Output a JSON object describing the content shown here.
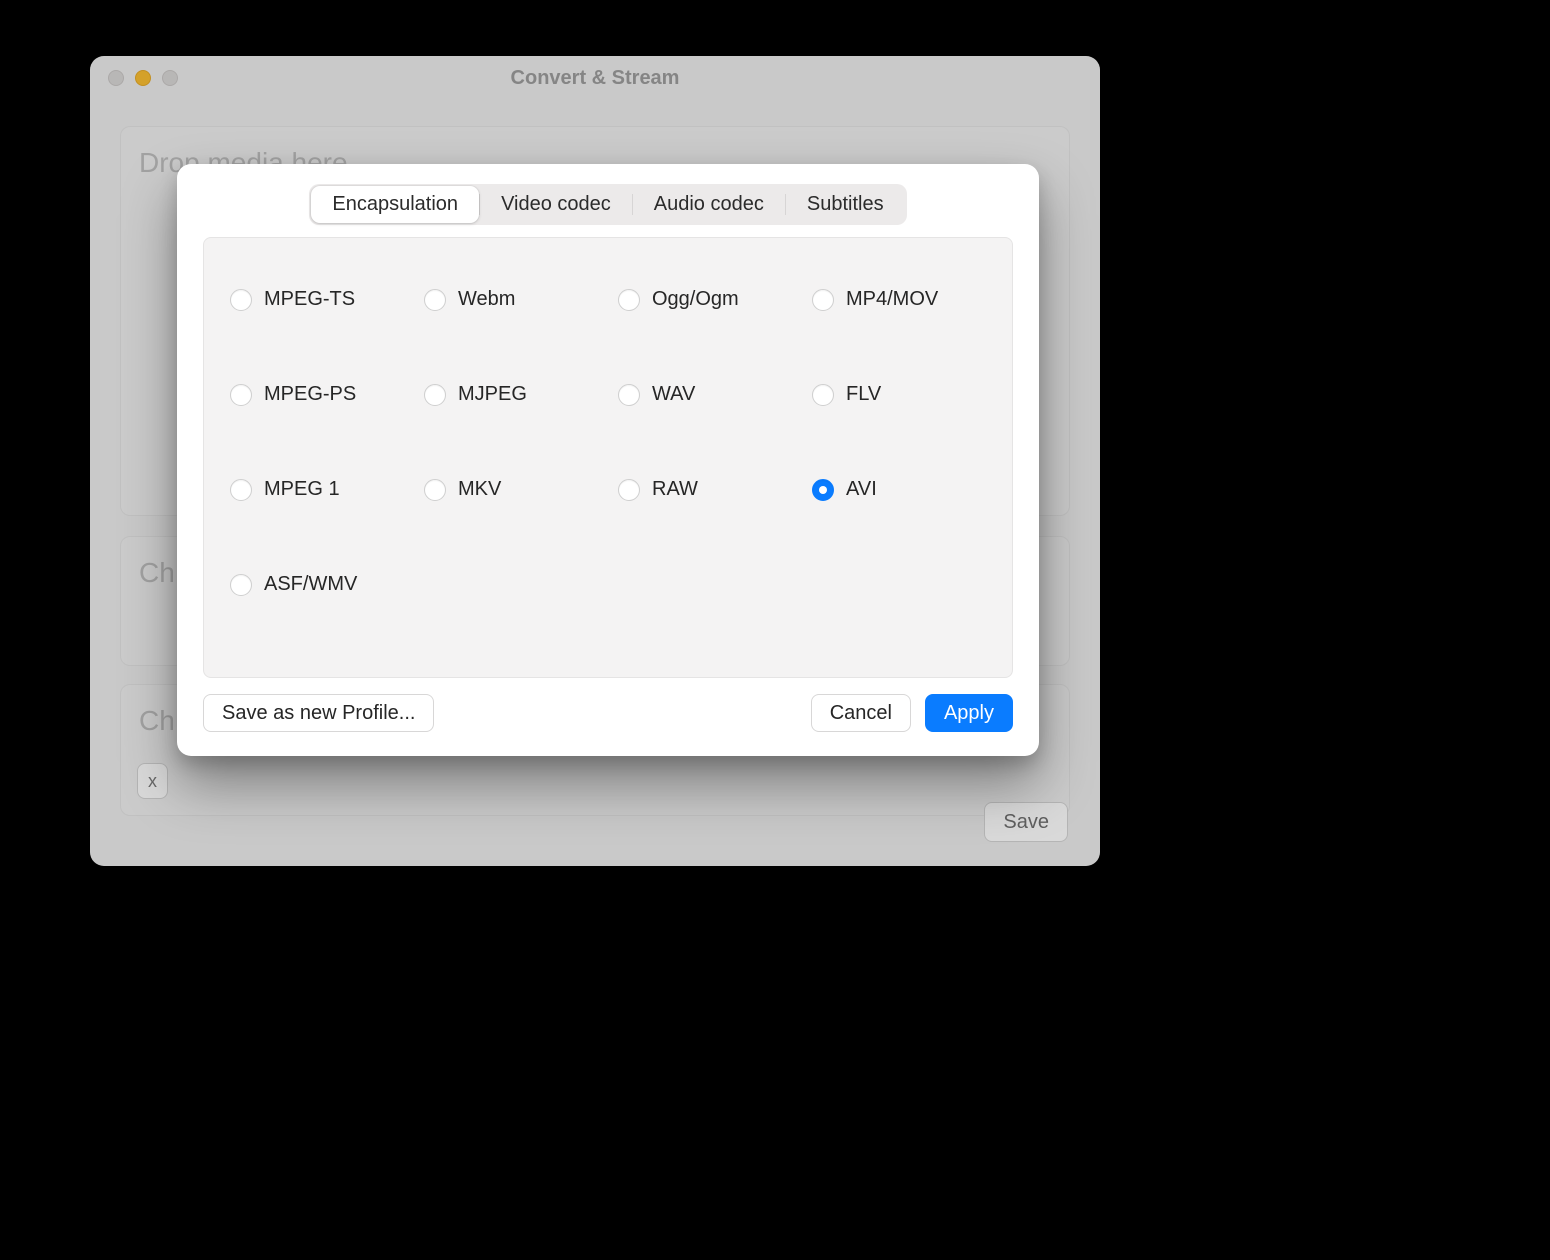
{
  "window": {
    "title": "Convert & Stream",
    "drop_label": "Drop media here",
    "section2_label": "Ch",
    "section3_label": "Ch",
    "section3_pill": "x",
    "save_label": "Save"
  },
  "sheet": {
    "tabs": [
      {
        "id": "encapsulation",
        "label": "Encapsulation",
        "active": true
      },
      {
        "id": "video-codec",
        "label": "Video codec",
        "active": false
      },
      {
        "id": "audio-codec",
        "label": "Audio codec",
        "active": false
      },
      {
        "id": "subtitles",
        "label": "Subtitles",
        "active": false
      }
    ],
    "options": [
      {
        "id": "mpeg-ts",
        "label": "MPEG-TS",
        "selected": false
      },
      {
        "id": "webm",
        "label": "Webm",
        "selected": false
      },
      {
        "id": "ogg",
        "label": "Ogg/Ogm",
        "selected": false
      },
      {
        "id": "mp4",
        "label": "MP4/MOV",
        "selected": false
      },
      {
        "id": "mpeg-ps",
        "label": "MPEG-PS",
        "selected": false
      },
      {
        "id": "mjpeg",
        "label": "MJPEG",
        "selected": false
      },
      {
        "id": "wav",
        "label": "WAV",
        "selected": false
      },
      {
        "id": "flv",
        "label": "FLV",
        "selected": false
      },
      {
        "id": "mpeg1",
        "label": "MPEG 1",
        "selected": false
      },
      {
        "id": "mkv",
        "label": "MKV",
        "selected": false
      },
      {
        "id": "raw",
        "label": "RAW",
        "selected": false
      },
      {
        "id": "avi",
        "label": "AVI",
        "selected": true
      },
      {
        "id": "asf",
        "label": "ASF/WMV",
        "selected": false
      }
    ],
    "buttons": {
      "save_profile": "Save as new Profile...",
      "cancel": "Cancel",
      "apply": "Apply"
    }
  }
}
